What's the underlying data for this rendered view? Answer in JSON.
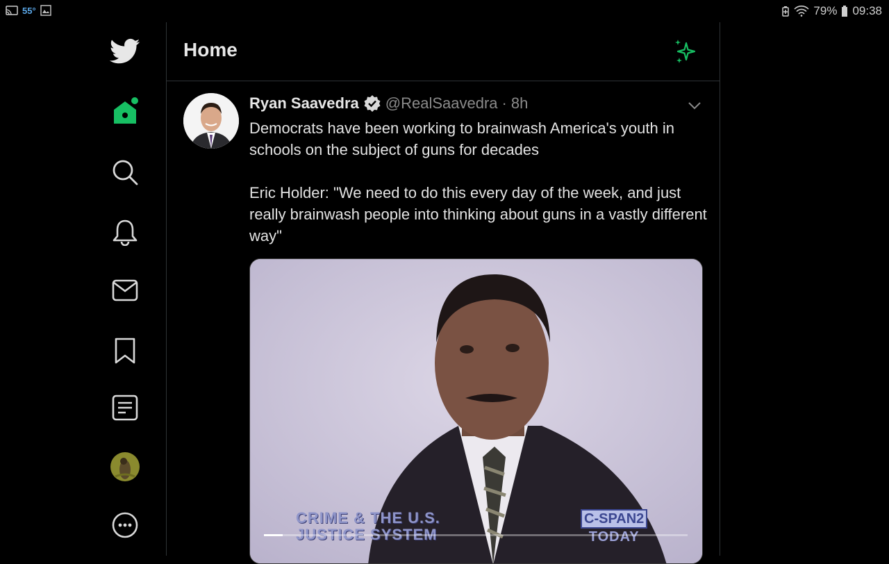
{
  "status_bar": {
    "temperature": "55°",
    "battery": "79%",
    "time": "09:38"
  },
  "sidebar": {
    "items": [
      {
        "name": "twitter-logo-icon"
      },
      {
        "name": "home-icon",
        "active": true
      },
      {
        "name": "search-icon"
      },
      {
        "name": "notifications-icon"
      },
      {
        "name": "messages-icon"
      },
      {
        "name": "bookmarks-icon"
      },
      {
        "name": "lists-icon"
      },
      {
        "name": "profile-avatar"
      },
      {
        "name": "more-icon"
      }
    ],
    "accent_color": "#17bf63"
  },
  "header": {
    "title": "Home"
  },
  "tweet": {
    "author_name": "Ryan Saavedra",
    "verified": true,
    "handle": "@RealSaavedra",
    "separator": "·",
    "time": "8h",
    "text_paragraphs": [
      "Democrats have been working to brainwash America's youth in schools on the subject of guns for decades",
      "Eric Holder: \"We need to do this every day of the week, and just really brainwash people into thinking about guns in a vastly different way\""
    ],
    "media": {
      "caption_line1": "CRIME & THE U.S.",
      "caption_line2": "JUSTICE SYSTEM",
      "network_logo": "C-SPAN2",
      "network_sub": "TODAY",
      "progress_fraction": 0.045
    }
  }
}
